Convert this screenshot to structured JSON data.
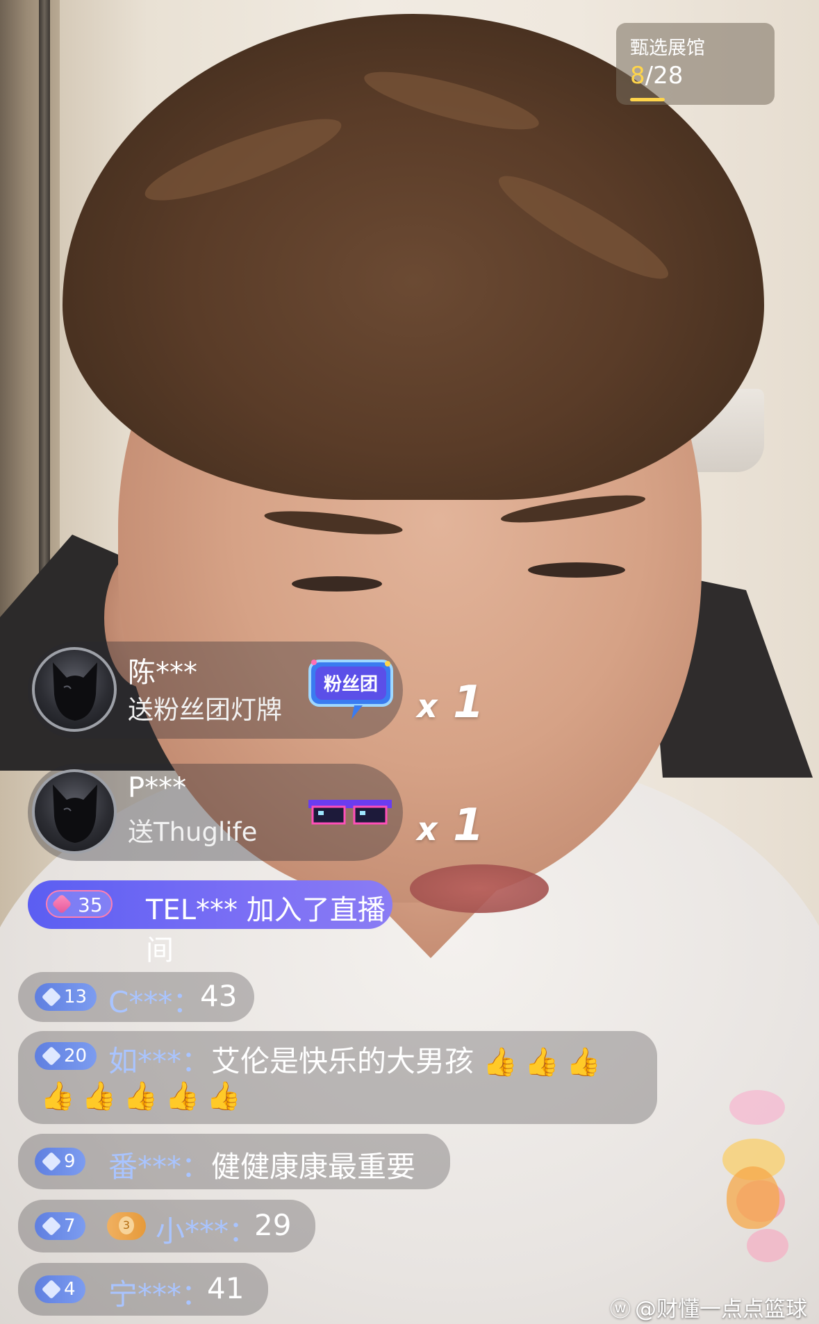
{
  "gallery": {
    "title": "甄选展馆",
    "current": "8",
    "total": "/28"
  },
  "gifts": [
    {
      "name": "陈***",
      "text": "送粉丝团灯牌",
      "icon": "fan-club-badge-icon",
      "icon_label": "粉丝团",
      "multiplier_x": "x",
      "multiplier_n": "1"
    },
    {
      "name": "P***",
      "text": "送Thuglife",
      "icon": "pixel-sunglasses-icon",
      "multiplier_x": "x",
      "multiplier_n": "1"
    }
  ],
  "join": {
    "level": "35",
    "user": "TEL***",
    "action": "加入了直播间"
  },
  "chat": [
    {
      "level": "13",
      "user": "C***：",
      "text": "43"
    },
    {
      "level": "20",
      "user": "如***：",
      "text": "艾伦是快乐的大男孩",
      "thumbs_line1": 3,
      "thumbs_line2": 5
    },
    {
      "level": "9",
      "user": "番***：",
      "text": "健健康康最重要"
    },
    {
      "level": "7",
      "fan_level": "3",
      "user": "小***：",
      "text": "29"
    },
    {
      "level": "4",
      "user": "宁***：",
      "text": "41"
    }
  ],
  "thumb_emoji": "👍",
  "watermark": {
    "logo": "weibo-logo-icon",
    "text": "@财懂一点点篮球"
  },
  "colors": {
    "join_banner": "#6b66f4",
    "level_badge": "#6d8ee8",
    "username": "#a9c4ff",
    "gallery_accent": "#ffd54a"
  }
}
